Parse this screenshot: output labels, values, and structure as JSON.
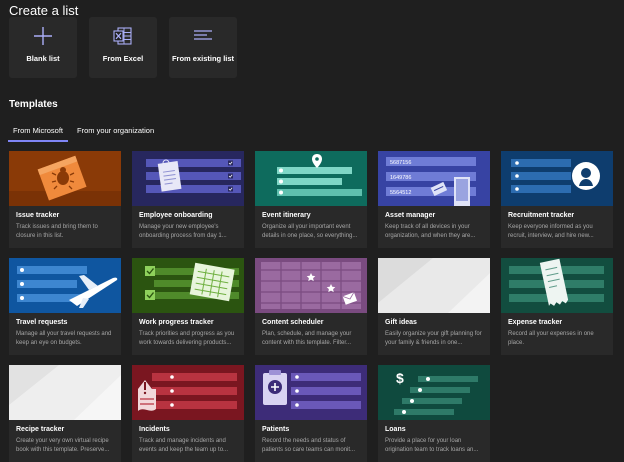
{
  "create": {
    "heading": "Create a list",
    "options": [
      {
        "label": "Blank list",
        "icon": "plus-icon"
      },
      {
        "label": "From Excel",
        "icon": "excel-icon"
      },
      {
        "label": "From existing list",
        "icon": "list-lines-icon"
      }
    ]
  },
  "templates": {
    "heading": "Templates",
    "tabs": [
      {
        "label": "From Microsoft",
        "selected": true
      },
      {
        "label": "From your organization",
        "selected": false
      }
    ],
    "cards": [
      {
        "title": "Issue tracker",
        "description": "Track issues and bring them to closure in this list.",
        "color": "#8a3a07"
      },
      {
        "title": "Employee onboarding",
        "description": "Manage your new employee's onboarding process from day 1...",
        "color": "#27275e"
      },
      {
        "title": "Event itinerary",
        "description": "Organize all your important event details in one place, so everything...",
        "color": "#0e6b5d"
      },
      {
        "title": "Asset manager",
        "description": "Keep track of all devices in your organization, and when they are...",
        "color": "#3743a3"
      },
      {
        "title": "Recruitment tracker",
        "description": "Keep everyone informed as you recruit, interview, and hire new...",
        "color": "#0e3d6e"
      },
      {
        "title": "Travel requests",
        "description": "Manage all your travel requests and keep an eye on budgets.",
        "color": "#0f56a0"
      },
      {
        "title": "Work progress tracker",
        "description": "Track priorities and progress as you work towards delivering products...",
        "color": "#2b5410"
      },
      {
        "title": "Content scheduler",
        "description": "Plan, schedule, and manage your content with this template. Filter...",
        "color": "#7a4b80"
      },
      {
        "title": "Gift ideas",
        "description": "Easily organize your gift planning for your family & friends in one...",
        "color": "#e9e9e9"
      },
      {
        "title": "Expense tracker",
        "description": "Record all your expenses in one place.",
        "color": "#124d3f"
      },
      {
        "title": "Recipe tracker",
        "description": "Create your very own virtual recipe book with this template. Preserve...",
        "color": "#eeeeee"
      },
      {
        "title": "Incidents",
        "description": "Track and manage incidents and events and keep the team up to...",
        "color": "#7a1620"
      },
      {
        "title": "Patients",
        "description": "Record the needs and status of patients so care teams can monit...",
        "color": "#3d2c78"
      },
      {
        "title": "Loans",
        "description": "Provide a place for your loan origination team to track loans an...",
        "color": "#0f4a3e"
      }
    ]
  },
  "thumb_text": {
    "asset_numbers": [
      "5687156",
      "1649786",
      "5564512"
    ]
  }
}
